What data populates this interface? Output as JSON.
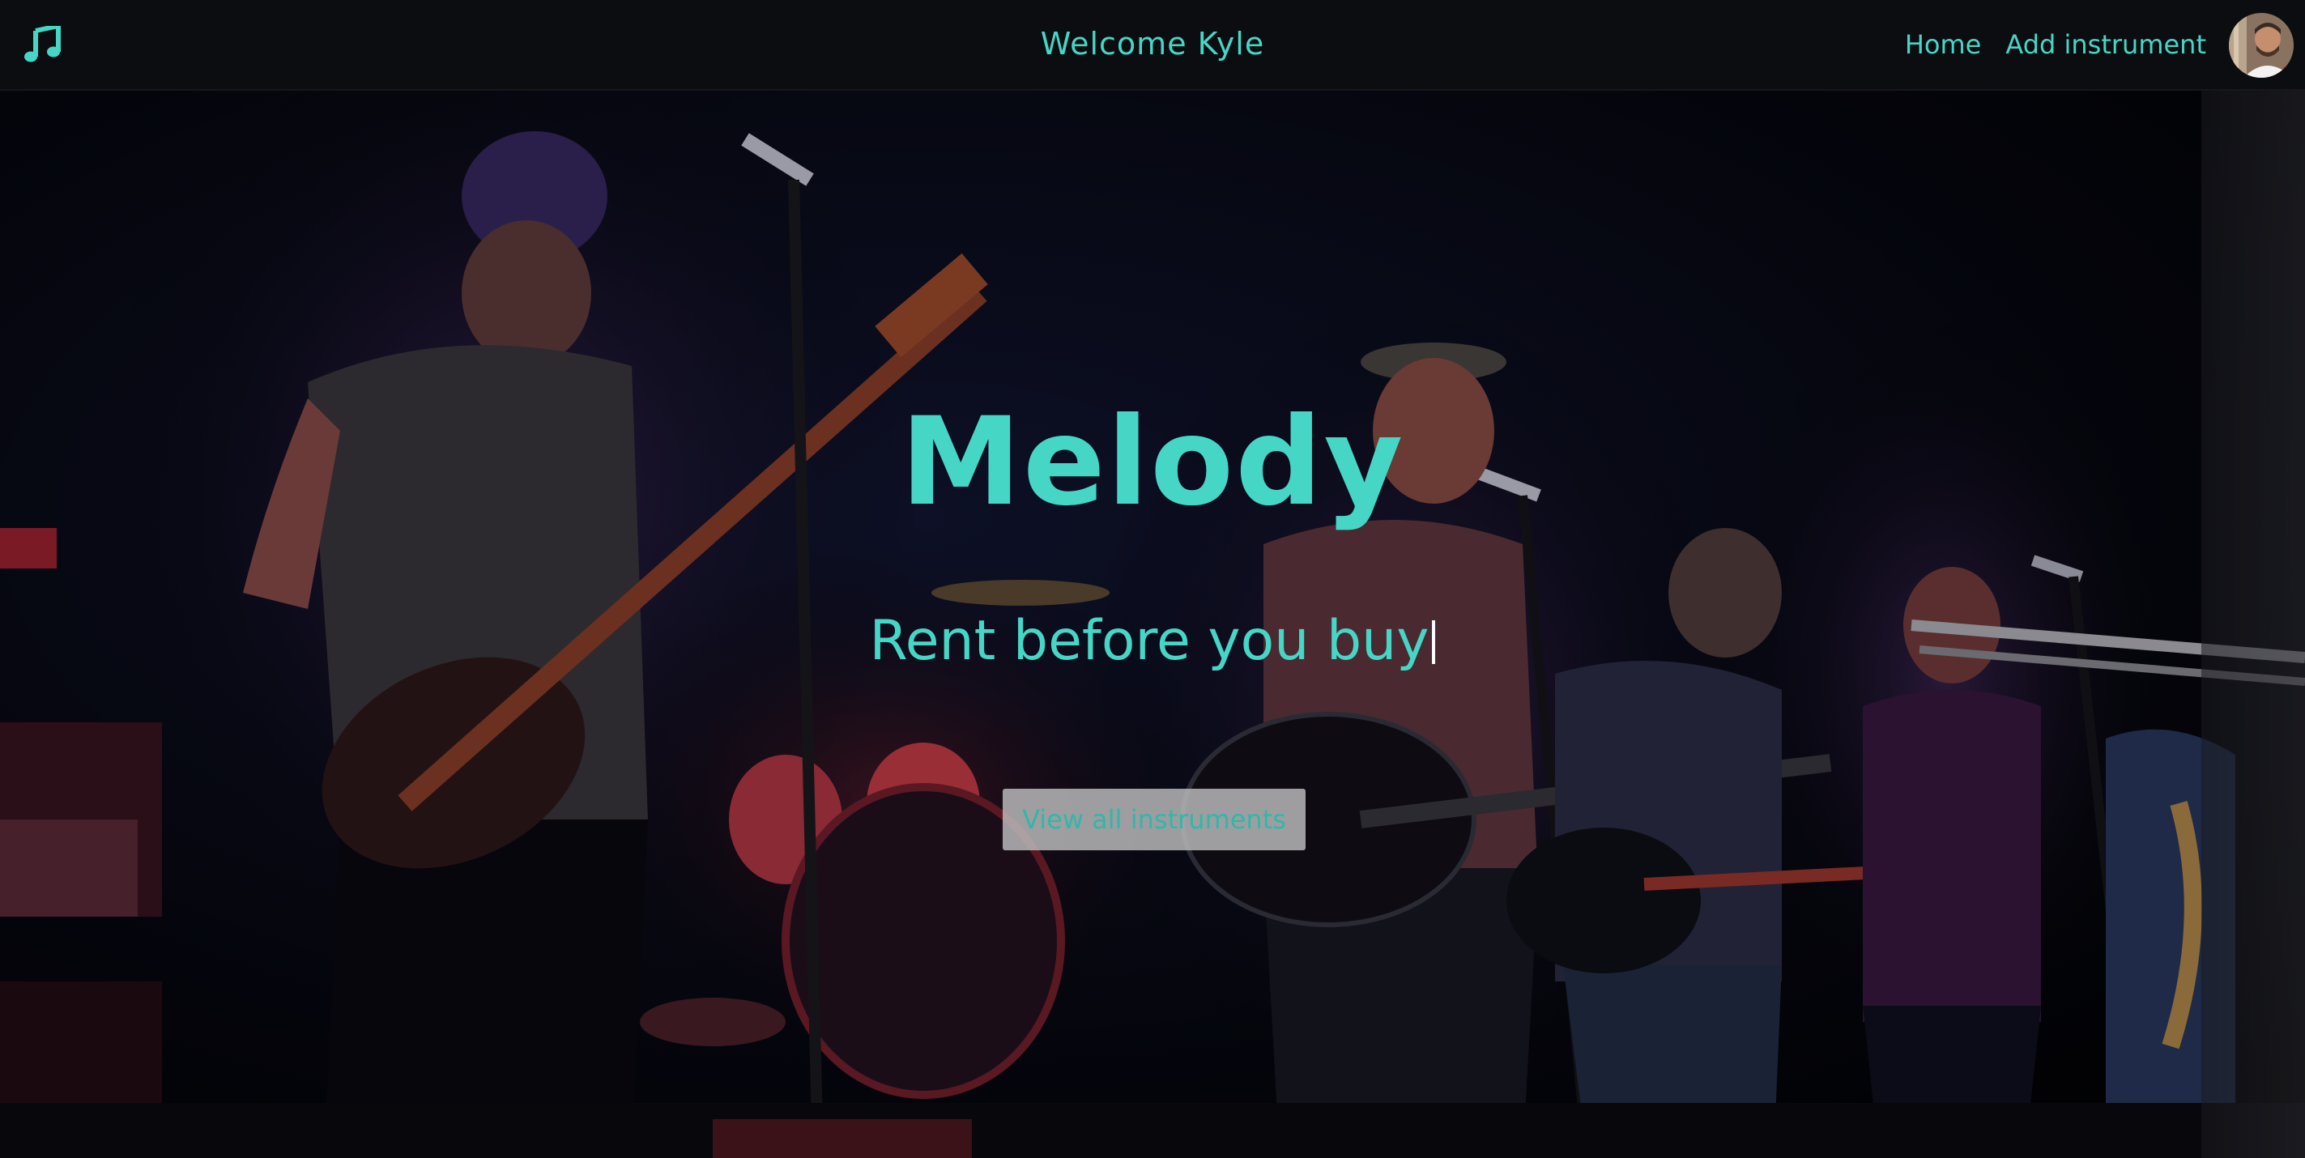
{
  "navbar": {
    "logo_icon": "music-note-icon",
    "welcome_text": "Welcome Kyle",
    "links": [
      {
        "label": "Home"
      },
      {
        "label": "Add instrument"
      }
    ],
    "avatar_icon": "user-avatar"
  },
  "hero": {
    "title": "Melody",
    "subtitle": "Rent before you buy",
    "cta_label": "View all instruments",
    "background": "band-performing-on-stage-photo"
  },
  "colors": {
    "accent": "#46d6c6",
    "navbar_bg": "#0c0d10",
    "button_bg": "#bebec0"
  }
}
